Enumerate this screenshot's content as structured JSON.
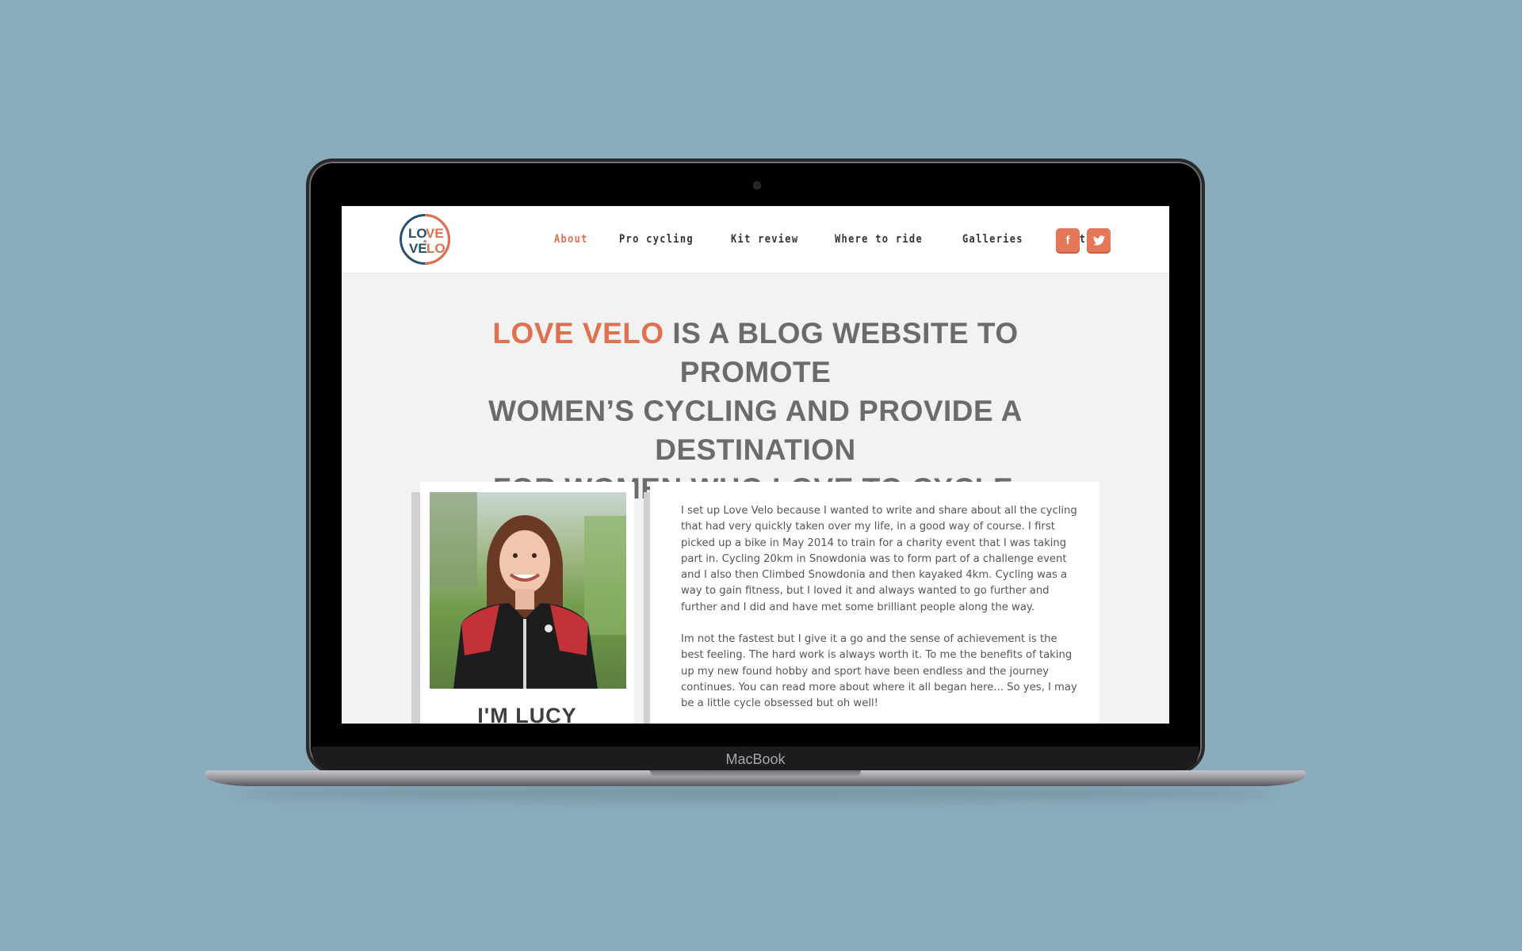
{
  "device": {
    "brand": "MacBook"
  },
  "site": {
    "logo": {
      "top": "LOVE",
      "bottom": "VELO",
      "colors": {
        "blue": "#26506b",
        "orange": "#e0704f"
      }
    },
    "nav": [
      {
        "label": "About",
        "active": true
      },
      {
        "label": "Pro cycling",
        "active": false
      },
      {
        "label": "Kit review",
        "active": false
      },
      {
        "label": "Where to ride",
        "active": false
      },
      {
        "label": "Galleries",
        "active": false
      },
      {
        "label": "Contact",
        "active": false
      }
    ],
    "social": {
      "facebook": "f",
      "twitter": "twitter"
    },
    "hero": {
      "accent": "LOVE VELO",
      "line1_rest": " IS A BLOG WEBSITE TO PROMOTE",
      "line2": "WOMEN’S CYCLING AND PROVIDE A DESTINATION",
      "line3": "FOR WOMEN WHO LOVE TO CYCLE",
      "punct": "."
    },
    "profile": {
      "name": "I'M LUCY"
    },
    "bio": {
      "p1": "I set up Love Velo because I wanted to write and share about all the cycling that had very quickly taken over my life, in a good way of course. I first picked up a bike in May 2014 to train for a charity event that I was taking part in. Cycling 20km in Snowdonia was to form part of a challenge event and I also then Climbed Snowdonia and then kayaked 4km. Cycling was a way to gain fitness, but I loved it and always wanted to go further and further and I did and have met some brilliant people along the way.",
      "p2": "Im not the fastest but I give it a go and the sense of achievement is the best feeling. The hard work is always worth it. To me the benefits of taking up my new found hobby and sport have been endless and the journey continues. You can read more about where it all began here... So yes, I may be a little cycle obsessed but oh well!"
    },
    "colors": {
      "accent": "#e0704f",
      "page_bg": "#f2f2f2",
      "backdrop": "#8aabbb"
    }
  }
}
